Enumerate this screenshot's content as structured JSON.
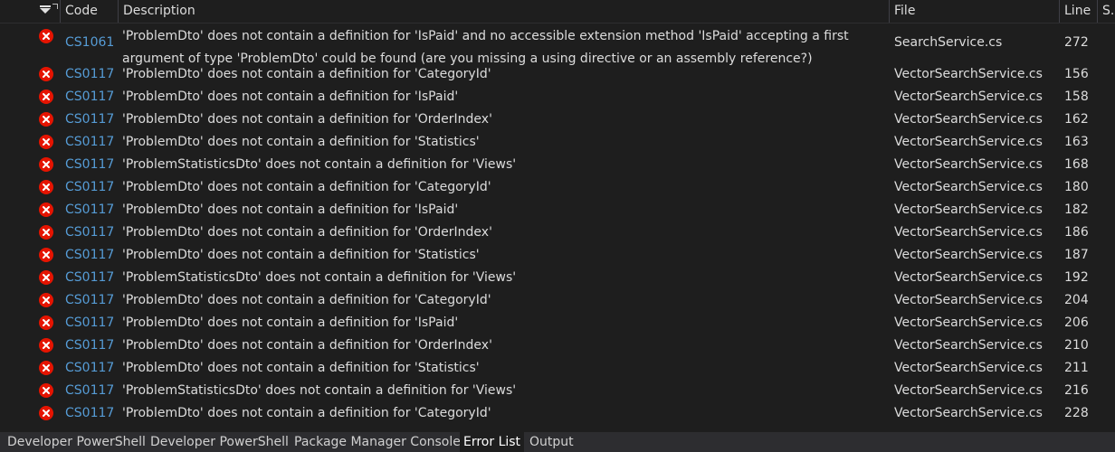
{
  "columns": {
    "code": "Code",
    "description": "Description",
    "file": "File",
    "line": "Line",
    "suppression": "S..."
  },
  "rows": [
    {
      "code": "CS1061",
      "description": "'ProblemDto' does not contain a definition for 'IsPaid' and no accessible extension method 'IsPaid' accepting a first argument of type 'ProblemDto' could be found (are you missing a using directive or an assembly reference?)",
      "file": "SearchService.cs",
      "line": "272"
    },
    {
      "code": "CS0117",
      "description": "'ProblemDto' does not contain a definition for 'CategoryId'",
      "file": "VectorSearchService.cs",
      "line": "156"
    },
    {
      "code": "CS0117",
      "description": "'ProblemDto' does not contain a definition for 'IsPaid'",
      "file": "VectorSearchService.cs",
      "line": "158"
    },
    {
      "code": "CS0117",
      "description": "'ProblemDto' does not contain a definition for 'OrderIndex'",
      "file": "VectorSearchService.cs",
      "line": "162"
    },
    {
      "code": "CS0117",
      "description": "'ProblemDto' does not contain a definition for 'Statistics'",
      "file": "VectorSearchService.cs",
      "line": "163"
    },
    {
      "code": "CS0117",
      "description": "'ProblemStatisticsDto' does not contain a definition for 'Views'",
      "file": "VectorSearchService.cs",
      "line": "168"
    },
    {
      "code": "CS0117",
      "description": "'ProblemDto' does not contain a definition for 'CategoryId'",
      "file": "VectorSearchService.cs",
      "line": "180"
    },
    {
      "code": "CS0117",
      "description": "'ProblemDto' does not contain a definition for 'IsPaid'",
      "file": "VectorSearchService.cs",
      "line": "182"
    },
    {
      "code": "CS0117",
      "description": "'ProblemDto' does not contain a definition for 'OrderIndex'",
      "file": "VectorSearchService.cs",
      "line": "186"
    },
    {
      "code": "CS0117",
      "description": "'ProblemDto' does not contain a definition for 'Statistics'",
      "file": "VectorSearchService.cs",
      "line": "187"
    },
    {
      "code": "CS0117",
      "description": "'ProblemStatisticsDto' does not contain a definition for 'Views'",
      "file": "VectorSearchService.cs",
      "line": "192"
    },
    {
      "code": "CS0117",
      "description": "'ProblemDto' does not contain a definition for 'CategoryId'",
      "file": "VectorSearchService.cs",
      "line": "204"
    },
    {
      "code": "CS0117",
      "description": "'ProblemDto' does not contain a definition for 'IsPaid'",
      "file": "VectorSearchService.cs",
      "line": "206"
    },
    {
      "code": "CS0117",
      "description": "'ProblemDto' does not contain a definition for 'OrderIndex'",
      "file": "VectorSearchService.cs",
      "line": "210"
    },
    {
      "code": "CS0117",
      "description": "'ProblemDto' does not contain a definition for 'Statistics'",
      "file": "VectorSearchService.cs",
      "line": "211"
    },
    {
      "code": "CS0117",
      "description": "'ProblemStatisticsDto' does not contain a definition for 'Views'",
      "file": "VectorSearchService.cs",
      "line": "216"
    },
    {
      "code": "CS0117",
      "description": "'ProblemDto' does not contain a definition for 'CategoryId'",
      "file": "VectorSearchService.cs",
      "line": "228"
    }
  ],
  "tabs": [
    {
      "label": "Developer PowerShell",
      "active": false
    },
    {
      "label": "Developer PowerShell",
      "active": false
    },
    {
      "label": "Package Manager Console",
      "active": false
    },
    {
      "label": "Error List",
      "active": true
    },
    {
      "label": "Output",
      "active": false
    }
  ],
  "icons": {
    "sort": "sort-dropdown-icon",
    "error": "error-icon"
  },
  "colors": {
    "background": "#1e1e1e",
    "error": "#e51400",
    "code_link": "#569cd6",
    "text": "#dcdcdc",
    "tab_bar": "#2d2d30"
  }
}
